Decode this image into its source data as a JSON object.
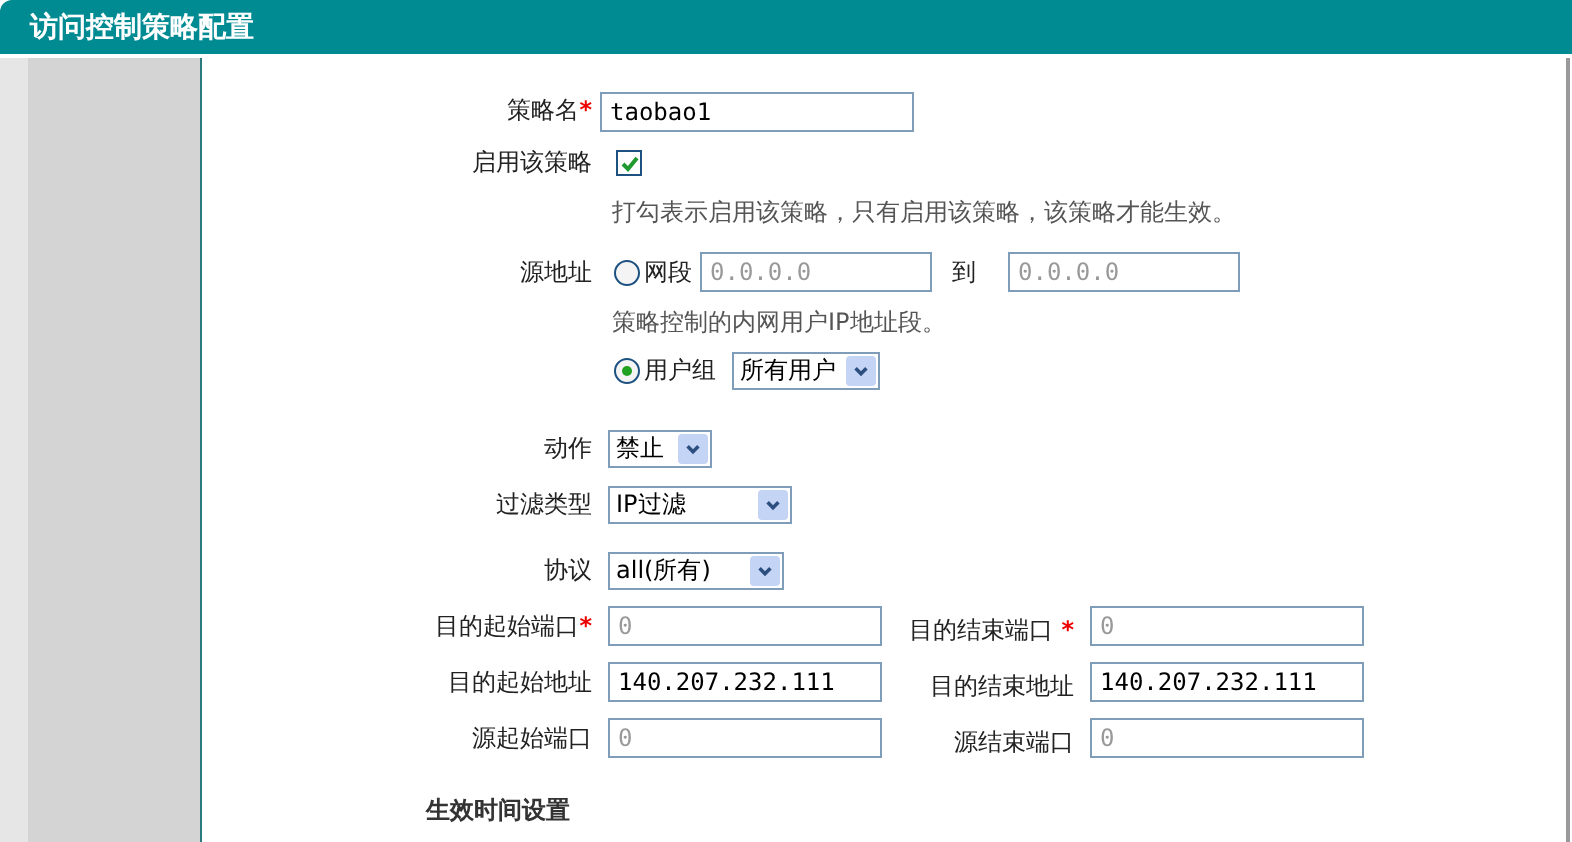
{
  "header": {
    "title": "访问控制策略配置"
  },
  "form": {
    "policy_name": {
      "label": "策略名",
      "marker": "*",
      "value": "taobao1"
    },
    "enable": {
      "label": "启用该策略",
      "checked": true,
      "hint": "打勾表示启用该策略，只有启用该策略，该策略才能生效。"
    },
    "source_address": {
      "label": "源地址",
      "options": [
        {
          "kind": "range",
          "label": "网段",
          "selected": false,
          "start_placeholder": "0.0.0.0",
          "to_label": "到",
          "end_placeholder": "0.0.0.0",
          "hint": "策略控制的内网用户IP地址段。"
        },
        {
          "kind": "group",
          "label": "用户组",
          "selected": true,
          "value": "所有用户"
        }
      ]
    },
    "selects": [
      {
        "label": "动作",
        "value": "禁止"
      },
      {
        "label": "过滤类型",
        "value": "IP过滤"
      },
      {
        "label": "协议",
        "value": "all(所有)"
      }
    ],
    "field_pairs": [
      {
        "left": {
          "label": "目的起始端口",
          "marker": "*",
          "placeholder": "0"
        },
        "right": {
          "label": "目的结束端口",
          "marker": "*",
          "placeholder": "0"
        }
      },
      {
        "left": {
          "label": "目的起始地址",
          "value": "140.207.232.111"
        },
        "right": {
          "label": "目的结束地址",
          "value": "140.207.232.111"
        }
      },
      {
        "left": {
          "label": "源起始端口",
          "placeholder": "0"
        },
        "right": {
          "label": "源结束端口",
          "placeholder": "0"
        }
      }
    ],
    "section_title": "生效时间设置"
  }
}
